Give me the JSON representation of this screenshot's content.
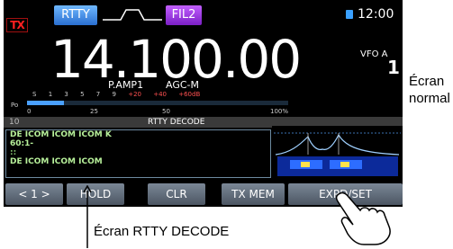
{
  "top_bar": {
    "tx_indicator": "TX",
    "mode": "RTTY",
    "filter": "FIL2",
    "clock": "12:00"
  },
  "frequency": {
    "value": "14.100.00",
    "vfo_label": "VFO A",
    "vfo_number": "1"
  },
  "status": {
    "preamp": "P.AMP1",
    "agc": "AGC-M"
  },
  "meter": {
    "s_scale": [
      "S",
      "1",
      "3",
      "5",
      "7",
      "9",
      "+20",
      "+40",
      "+60dB"
    ],
    "po_label": "Po",
    "po_scale": [
      "0",
      "25",
      "50",
      "100%"
    ],
    "level_fraction": 0.14
  },
  "decode": {
    "bar_number": "10",
    "bar_title": "RTTY DECODE",
    "lines": [
      "DE ICOM ICOM ICOM K",
      "60:1-",
      ":: ",
      "DE ICOM ICOM ICOM"
    ]
  },
  "buttons": {
    "page": "< 1 >",
    "hold": "HOLD",
    "clear": "CLR",
    "tx_mem": "TX MEM",
    "expd_set": "EXPD/SET"
  },
  "captions": {
    "normal_line1": "Écran",
    "normal_line2": "normal",
    "decode_screen": "Écran RTTY DECODE"
  },
  "colors": {
    "mode_button": "#2a6fd0",
    "filter_button": "#7b1fc5",
    "tx_red": "#ff2020",
    "decode_text": "#b7f09a",
    "meter_fill": "#4aa0ff"
  }
}
